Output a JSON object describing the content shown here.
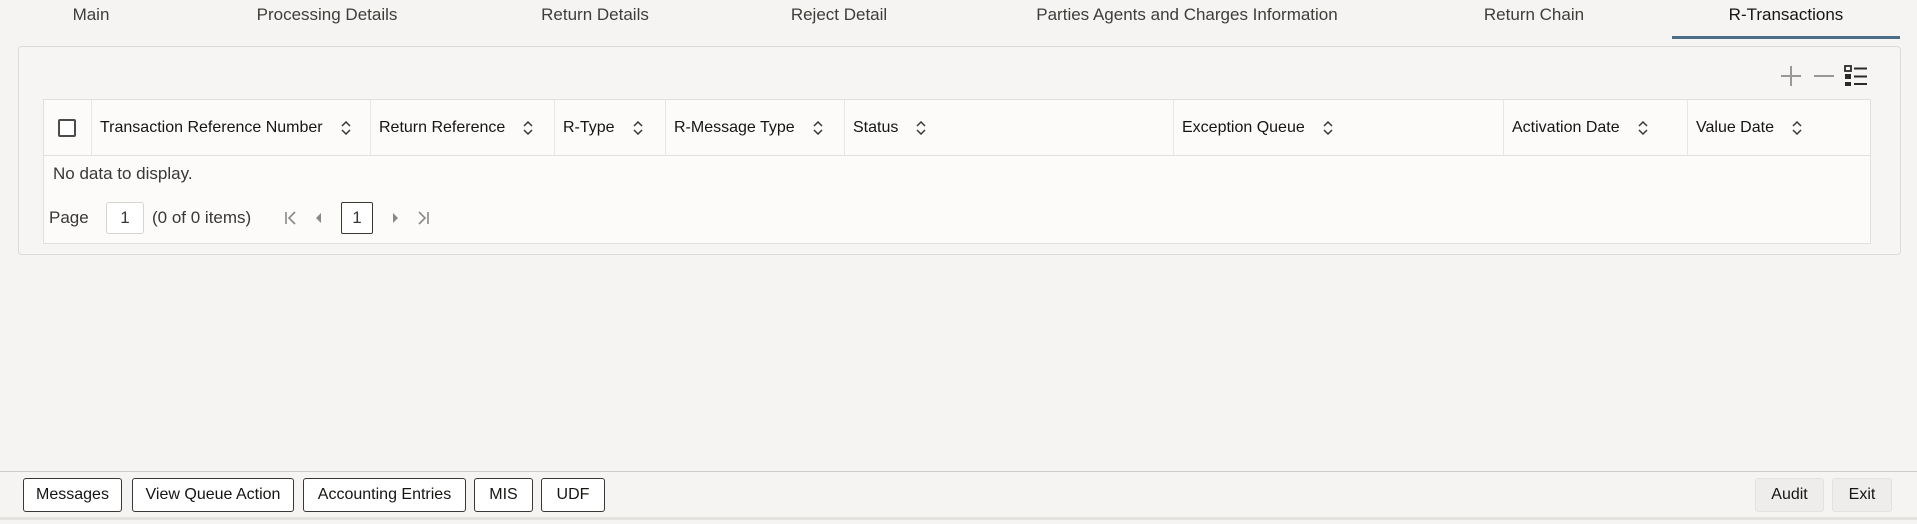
{
  "tabs": [
    {
      "label": "Main"
    },
    {
      "label": "Processing Details"
    },
    {
      "label": "Return Details"
    },
    {
      "label": "Reject Detail"
    },
    {
      "label": "Parties Agents and Charges Information"
    },
    {
      "label": "Return Chain"
    },
    {
      "label": "R-Transactions"
    }
  ],
  "active_tab": "R-Transactions",
  "toolbar": {
    "add_icon": "plus-icon",
    "remove_icon": "minus-icon",
    "columns_icon": "list-icon"
  },
  "table": {
    "columns": [
      {
        "label": "Transaction Reference Number"
      },
      {
        "label": "Return Reference"
      },
      {
        "label": "R-Type"
      },
      {
        "label": "R-Message Type"
      },
      {
        "label": "Status"
      },
      {
        "label": "Exception Queue"
      },
      {
        "label": "Activation Date"
      },
      {
        "label": "Value Date"
      }
    ],
    "empty_message": "No data to display."
  },
  "pager": {
    "page_label": "Page",
    "page_value": "1",
    "count_text": "(0 of 0 items)",
    "current_page": "1"
  },
  "footer": {
    "buttons": [
      {
        "label": "Messages"
      },
      {
        "label": "View Queue Action"
      },
      {
        "label": "Accounting Entries"
      },
      {
        "label": "MIS"
      },
      {
        "label": "UDF"
      }
    ],
    "audit_label": "Audit",
    "exit_label": "Exit"
  },
  "colors": {
    "active_tab_underline": "#4c6e89",
    "background": "#f5f4f2"
  }
}
